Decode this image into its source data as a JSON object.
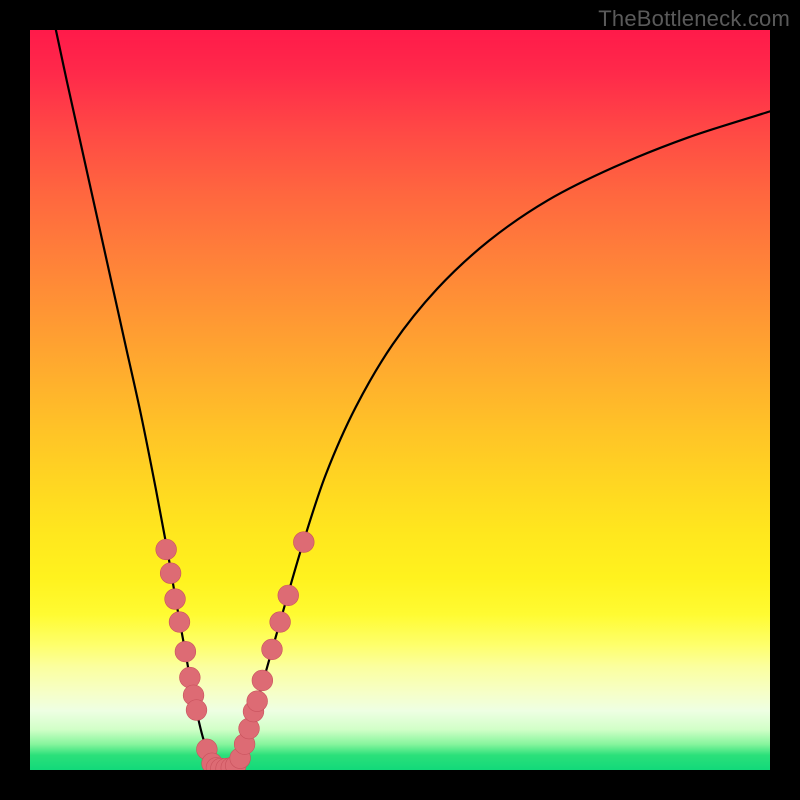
{
  "watermark": "TheBottleneck.com",
  "colors": {
    "background": "#000000",
    "curve": "#000000",
    "marker_fill": "#dd6b74",
    "marker_stroke": "#c9525d"
  },
  "chart_data": {
    "type": "line",
    "title": "",
    "xlabel": "",
    "ylabel": "",
    "xlim": [
      0,
      100
    ],
    "ylim": [
      0,
      100
    ],
    "grid": false,
    "legend": false,
    "series": [
      {
        "name": "left-branch",
        "x": [
          3.5,
          5,
          7,
          9,
          11,
          13,
          15,
          17,
          18.5,
          19.7,
          20.8,
          21.7,
          22.5,
          23.2,
          23.8,
          24.3,
          24.8
        ],
        "values": [
          100,
          93,
          84,
          75,
          66,
          57,
          48,
          38,
          30,
          23,
          17,
          12,
          8,
          5,
          3,
          1.5,
          0.5
        ]
      },
      {
        "name": "valley-floor",
        "x": [
          24.8,
          25.5,
          26.3,
          27.0,
          27.8
        ],
        "values": [
          0.5,
          0.2,
          0.15,
          0.2,
          0.5
        ]
      },
      {
        "name": "right-branch",
        "x": [
          27.8,
          28.5,
          29.5,
          30.8,
          32.5,
          34.5,
          37,
          40,
          44,
          49,
          55,
          62,
          70,
          79,
          89,
          100
        ],
        "values": [
          0.5,
          2.0,
          5.0,
          9.5,
          15.5,
          22.5,
          31.0,
          40.0,
          49.0,
          57.5,
          65.0,
          71.5,
          77.0,
          81.5,
          85.5,
          89.0
        ]
      }
    ],
    "markers": [
      {
        "x": 18.4,
        "y": 29.8,
        "r": 1.4
      },
      {
        "x": 19.0,
        "y": 26.6,
        "r": 1.4
      },
      {
        "x": 19.6,
        "y": 23.1,
        "r": 1.4
      },
      {
        "x": 20.2,
        "y": 20.0,
        "r": 1.4
      },
      {
        "x": 21.0,
        "y": 16.0,
        "r": 1.4
      },
      {
        "x": 21.6,
        "y": 12.5,
        "r": 1.4
      },
      {
        "x": 22.1,
        "y": 10.1,
        "r": 1.4
      },
      {
        "x": 22.5,
        "y": 8.1,
        "r": 1.4
      },
      {
        "x": 23.9,
        "y": 2.8,
        "r": 1.4
      },
      {
        "x": 24.6,
        "y": 0.9,
        "r": 1.4
      },
      {
        "x": 25.2,
        "y": 0.3,
        "r": 1.4
      },
      {
        "x": 25.8,
        "y": 0.2,
        "r": 1.4
      },
      {
        "x": 26.5,
        "y": 0.2,
        "r": 1.4
      },
      {
        "x": 27.2,
        "y": 0.3,
        "r": 1.4
      },
      {
        "x": 27.8,
        "y": 0.6,
        "r": 1.4
      },
      {
        "x": 28.4,
        "y": 1.6,
        "r": 1.4
      },
      {
        "x": 29.0,
        "y": 3.5,
        "r": 1.4
      },
      {
        "x": 29.6,
        "y": 5.6,
        "r": 1.4
      },
      {
        "x": 30.2,
        "y": 7.9,
        "r": 1.4
      },
      {
        "x": 30.7,
        "y": 9.3,
        "r": 1.4
      },
      {
        "x": 31.4,
        "y": 12.1,
        "r": 1.4
      },
      {
        "x": 32.7,
        "y": 16.3,
        "r": 1.4
      },
      {
        "x": 33.8,
        "y": 20.0,
        "r": 1.4
      },
      {
        "x": 34.9,
        "y": 23.6,
        "r": 1.4
      },
      {
        "x": 37.0,
        "y": 30.8,
        "r": 1.4
      }
    ]
  }
}
